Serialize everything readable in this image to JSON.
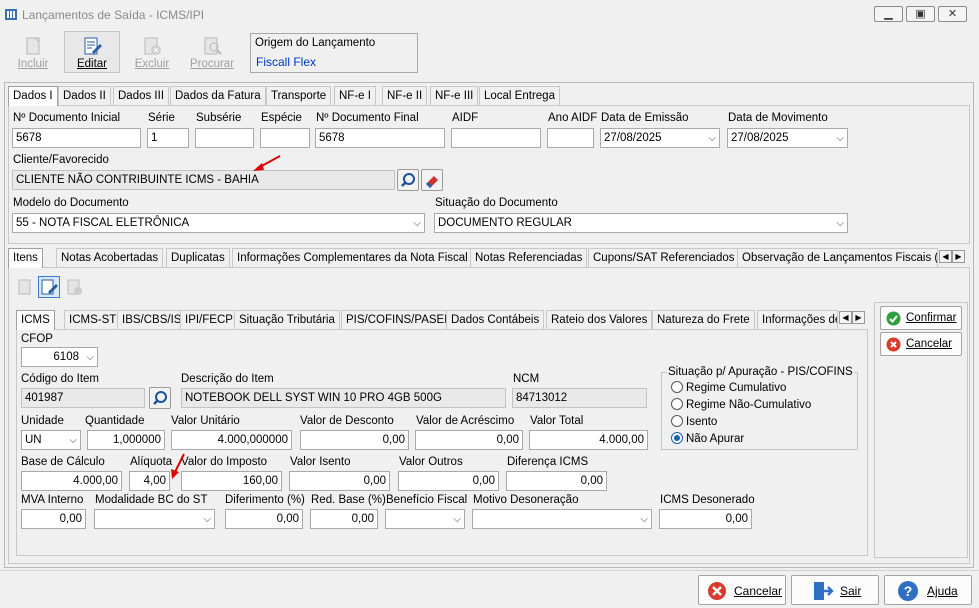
{
  "window": {
    "title": "Lançamentos de Saída - ICMS/IPI"
  },
  "toolbar": {
    "incluir": "Incluir",
    "editar": "Editar",
    "excluir": "Excluir",
    "procurar": "Procurar",
    "origem_label": "Origem do Lançamento",
    "origem_value": "Fiscall Flex"
  },
  "main_tabs": [
    "Dados I",
    "Dados II",
    "Dados III",
    "Dados da Fatura",
    "Transporte",
    "NF-e I",
    "NF-e II",
    "NF-e III",
    "Local Entrega"
  ],
  "header": {
    "doc_inicial_label": "Nº Documento Inicial",
    "doc_inicial": "5678",
    "serie_label": "Série",
    "serie": "1",
    "subserie_label": "Subsérie",
    "subserie": "",
    "especie_label": "Espécie",
    "especie": "",
    "doc_final_label": "Nº Documento Final",
    "doc_final": "5678",
    "aidf_label": "AIDF",
    "aidf": "",
    "ano_aidf_label": "Ano AIDF",
    "ano_aidf": "",
    "data_emissao_label": "Data de Emissão",
    "data_emissao": "27/08/2025",
    "data_mov_label": "Data de Movimento",
    "data_mov": "27/08/2025",
    "cliente_label": "Cliente/Favorecido",
    "cliente": "CLIENTE NÃO CONTRIBUINTE ICMS - BAHIA",
    "modelo_label": "Modelo do Documento",
    "modelo": "55 - NOTA FISCAL ELETRÔNICA",
    "situacao_label": "Situação do Documento",
    "situacao": "DOCUMENTO REGULAR"
  },
  "sub_tabs": [
    "Itens",
    "Notas Acobertadas",
    "Duplicatas",
    "Informações Complementares da Nota Fiscal",
    "Notas Referenciadas",
    "Cupons/SAT Referenciados",
    "Observação de Lançamentos Fiscais (C"
  ],
  "item_tabs": [
    "ICMS",
    "ICMS-ST",
    "IBS/CBS/IS",
    "IPI/FECP",
    "Situação Tributária",
    "PIS/COFINS/PASEP",
    "Dados Contábeis",
    "Rateio dos Valores",
    "Natureza do Frete",
    "Informações de"
  ],
  "item": {
    "cfop_label": "CFOP",
    "cfop": "6108",
    "codigo_label": "Código do Item",
    "codigo": "401987",
    "descricao_label": "Descrição do Item",
    "descricao": "NOTEBOOK DELL SYST WIN 10 PRO 4GB 500G",
    "ncm_label": "NCM",
    "ncm": "84713012",
    "unidade_label": "Unidade",
    "unidade": "UN",
    "quantidade_label": "Quantidade",
    "quantidade": "1,000000",
    "valor_unitario_label": "Valor Unitário",
    "valor_unitario": "4.000,000000",
    "valor_desconto_label": "Valor de Desconto",
    "valor_desconto": "0,00",
    "valor_acrescimo_label": "Valor de Acréscimo",
    "valor_acrescimo": "0,00",
    "valor_total_label": "Valor Total",
    "valor_total": "4.000,00",
    "base_calculo_label": "Base de Cálculo",
    "base_calculo": "4.000,00",
    "aliquota_label": "Alíquota",
    "aliquota": "4,00",
    "valor_imposto_label": "Valor do Imposto",
    "valor_imposto": "160,00",
    "valor_isento_label": "Valor Isento",
    "valor_isento": "0,00",
    "valor_outros_label": "Valor Outros",
    "valor_outros": "0,00",
    "diferenca_label": "Diferença ICMS",
    "diferenca": "0,00",
    "mva_label": "MVA Interno",
    "mva": "0,00",
    "modalidade_label": "Modalidade BC do ST",
    "modalidade": "",
    "diferimento_label": "Diferimento (%)",
    "diferimento": "0,00",
    "red_base_label": "Red. Base (%)",
    "red_base": "0,00",
    "beneficio_label": "Benefício Fiscal",
    "beneficio": "",
    "motivo_label": "Motivo Desoneração",
    "motivo": "",
    "icms_desonerado_label": "ICMS Desonerado",
    "icms_desonerado": "0,00"
  },
  "apuracao": {
    "title": "Situação p/ Apuração - PIS/COFINS",
    "options": [
      "Regime Cumulativo",
      "Regime Não-Cumulativo",
      "Isento",
      "Não Apurar"
    ],
    "selected": "Não Apurar"
  },
  "side_buttons": {
    "confirmar": "Confirmar",
    "cancelar": "Cancelar"
  },
  "footer": {
    "cancelar": "Cancelar",
    "sair": "Sair",
    "ajuda": "Ajuda"
  },
  "colors": {
    "accent_blue": "#1a5fb4",
    "annotation_red": "#e00000",
    "confirm_green": "#2e9e3e",
    "cancel_red": "#d83b2b"
  }
}
